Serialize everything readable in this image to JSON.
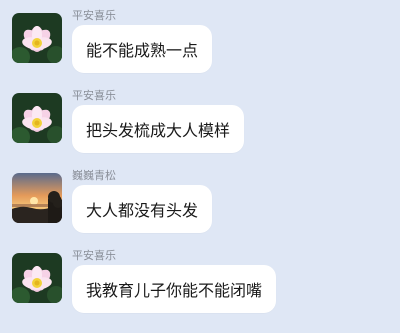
{
  "messages": [
    {
      "sender": "平安喜乐",
      "text": "能不能成熟一点",
      "avatar": "lotus-avatar"
    },
    {
      "sender": "平安喜乐",
      "text": "把头发梳成大人模样",
      "avatar": "lotus-avatar"
    },
    {
      "sender": "巍巍青松",
      "text": "大人都没有头发",
      "avatar": "sunset-avatar"
    },
    {
      "sender": "平安喜乐",
      "text": "我教育儿子你能不能闭嘴",
      "avatar": "lotus-avatar"
    }
  ],
  "colors": {
    "background": "#dfe7f5",
    "bubble": "#ffffff",
    "sender_text": "#8a8f99"
  }
}
